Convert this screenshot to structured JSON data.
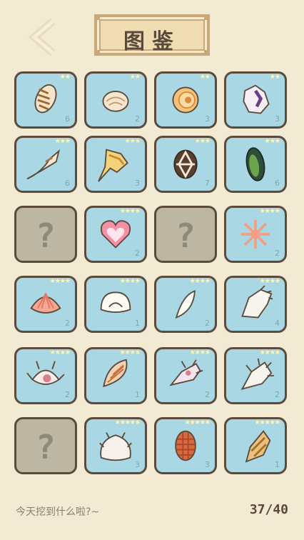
{
  "header": {
    "back_icon": "chevron-left-icon",
    "title": "图鉴"
  },
  "collection": [
    {
      "status": "found",
      "shell": "cone-shell",
      "stars": "★★",
      "count": "6"
    },
    {
      "status": "found",
      "shell": "round-snail-shell",
      "stars": "★★",
      "count": "2"
    },
    {
      "status": "found",
      "shell": "orange-spiral-shell",
      "stars": "★★",
      "count": "3"
    },
    {
      "status": "found",
      "shell": "purple-cowrie-shell",
      "stars": "★★",
      "count": "3"
    },
    {
      "status": "found",
      "shell": "spindle-shell",
      "stars": "★★★",
      "count": "6"
    },
    {
      "status": "found",
      "shell": "yellow-conch-shell",
      "stars": "★★★",
      "count": "3"
    },
    {
      "status": "found",
      "shell": "turtle-pattern-shell",
      "stars": "★★★",
      "count": "7"
    },
    {
      "status": "found",
      "shell": "green-mussel-shell",
      "stars": "★★★",
      "count": "6"
    },
    {
      "status": "unknown",
      "qmark": "?"
    },
    {
      "status": "found",
      "shell": "pink-heart-shell",
      "stars": "★★★★",
      "count": "2"
    },
    {
      "status": "unknown",
      "qmark": "?"
    },
    {
      "status": "found",
      "shell": "starfish-shell",
      "stars": "★★★★",
      "count": "2"
    },
    {
      "status": "found",
      "shell": "pink-scallop-shell",
      "stars": "★★★★",
      "count": "2"
    },
    {
      "status": "found",
      "shell": "white-clam-shell",
      "stars": "★★★★",
      "count": "1"
    },
    {
      "status": "found",
      "shell": "white-razor-shell",
      "stars": "★★★★",
      "count": "2"
    },
    {
      "status": "found",
      "shell": "white-spiky-conch-shell",
      "stars": "★★★★",
      "count": "4"
    },
    {
      "status": "found",
      "shell": "white-spider-conch-shell",
      "stars": "★★★★",
      "count": "2"
    },
    {
      "status": "found",
      "shell": "brown-striped-volute-shell",
      "stars": "★★★★",
      "count": "1"
    },
    {
      "status": "found",
      "shell": "pink-murex-shell",
      "stars": "★★★★",
      "count": "2"
    },
    {
      "status": "found",
      "shell": "white-murex-shell",
      "stars": "★★★★",
      "count": "2"
    },
    {
      "status": "unknown",
      "qmark": "?"
    },
    {
      "status": "found",
      "shell": "frilly-white-shell",
      "stars": "★★★★★",
      "count": "3"
    },
    {
      "status": "found",
      "shell": "orange-checkered-cowrie-shell",
      "stars": "★★★★★",
      "count": "3"
    },
    {
      "status": "found",
      "shell": "golden-whelk-shell",
      "stars": "★★★★★",
      "count": "1"
    }
  ],
  "footer": {
    "message": "今天挖到什么啦?~",
    "progress": "37/40"
  },
  "colors": {
    "background": "#f3ead3",
    "cell_found": "#a9d7e3",
    "cell_unknown": "#bdb6a3",
    "border": "#5c4a3b"
  }
}
